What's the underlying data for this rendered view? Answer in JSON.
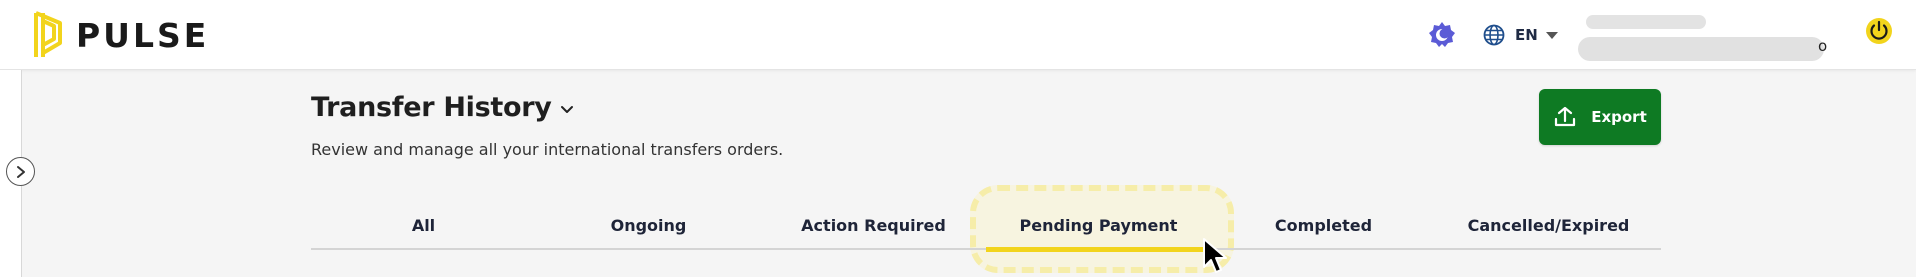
{
  "brand": {
    "name": "PULSE",
    "logo_color": "#f2d41c"
  },
  "header": {
    "theme_toggle_icon": "theme-toggle-icon",
    "language": {
      "icon": "globe-icon",
      "code": "EN"
    },
    "user": {
      "name_redacted": true,
      "email_redacted": true,
      "visible_tail": "o"
    },
    "power_icon": "power-icon"
  },
  "sidebar": {
    "expand_icon": "chevron-right-icon"
  },
  "page": {
    "title": "Transfer History",
    "subtitle": "Review and manage all your international transfers orders.",
    "export_label": "Export"
  },
  "tabs": [
    {
      "label": "All"
    },
    {
      "label": "Ongoing"
    },
    {
      "label": "Action Required"
    },
    {
      "label": "Pending Payment",
      "active": true
    },
    {
      "label": "Completed"
    },
    {
      "label": "Cancelled/Expired"
    }
  ],
  "colors": {
    "accent": "#f2d41c",
    "export_green": "#0e7a23",
    "theme_purple": "#5b5bd6"
  }
}
